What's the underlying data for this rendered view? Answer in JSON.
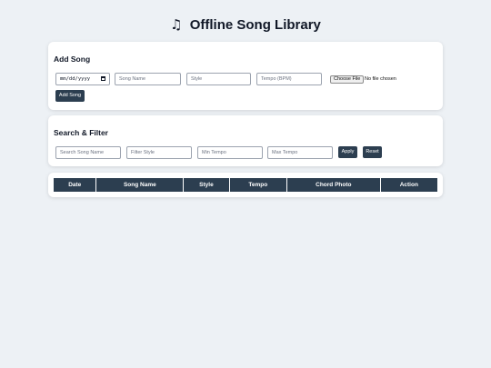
{
  "app": {
    "title": "Offline Song Library",
    "title_icon": "musical-note-icon"
  },
  "add_song": {
    "heading": "Add Song",
    "date_placeholder": "mm/dd/yyyy",
    "name_placeholder": "Song Name",
    "style_placeholder": "Style",
    "tempo_placeholder": "Tempo (BPM)",
    "file_button": "Choose File",
    "file_status": "No file chosen",
    "submit_label": "Add Song"
  },
  "search": {
    "heading": "Search & Filter",
    "search_placeholder": "Search Song Name",
    "style_placeholder": "Filter Style",
    "min_tempo_placeholder": "Min Tempo",
    "max_tempo_placeholder": "Max Tempo",
    "apply_label": "Apply",
    "reset_label": "Reset"
  },
  "table": {
    "columns": [
      "Date",
      "Song Name",
      "Style",
      "Tempo",
      "Chord Photo",
      "Action"
    ]
  },
  "colors": {
    "accent": "#2c3e50",
    "background": "#edf1f5"
  }
}
